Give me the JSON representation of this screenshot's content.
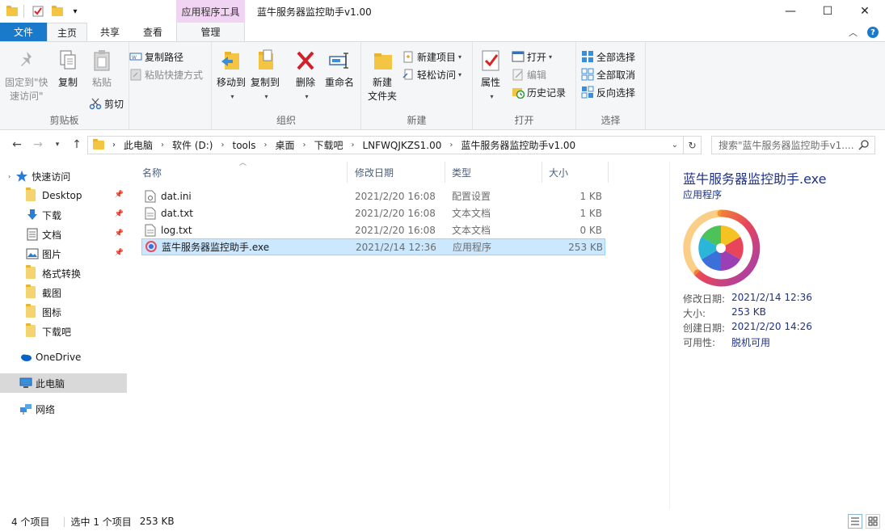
{
  "titlebar": {
    "context_tab_title": "应用程序工具",
    "window_title": "蓝牛服务器监控助手v1.00",
    "minimize": "—",
    "maximize": "☐",
    "close": "✕"
  },
  "tabs": {
    "file": "文件",
    "home": "主页",
    "share": "共享",
    "view": "查看",
    "manage": "管理",
    "collapse": "︿",
    "help": "?"
  },
  "ribbon": {
    "clipboard": {
      "label": "剪贴板",
      "pin_line1": "固定到\"快",
      "pin_line2": "速访问\"",
      "copy": "复制",
      "paste": "粘贴",
      "copy_path": "复制路径",
      "paste_shortcut": "粘贴快捷方式",
      "cut": "剪切"
    },
    "organize": {
      "label": "组织",
      "move_to": "移动到",
      "copy_to": "复制到",
      "delete": "删除",
      "rename": "重命名"
    },
    "new": {
      "label": "新建",
      "new_folder_line1": "新建",
      "new_folder_line2": "文件夹",
      "new_item": "新建项目",
      "easy_access": "轻松访问"
    },
    "open": {
      "label": "打开",
      "properties": "属性",
      "open": "打开",
      "edit": "编辑",
      "history": "历史记录"
    },
    "select": {
      "label": "选择",
      "select_all": "全部选择",
      "select_none": "全部取消",
      "invert": "反向选择"
    }
  },
  "address": {
    "crumbs": [
      "此电脑",
      "软件 (D:)",
      "tools",
      "桌面",
      "下载吧",
      "LNFWQJKZS1.00",
      "蓝牛服务器监控助手v1.00"
    ],
    "search_placeholder": "搜索\"蓝牛服务器监控助手v1...."
  },
  "sidebar": {
    "quick_access": "快速访问",
    "items": [
      {
        "label": "Desktop",
        "pinned": true
      },
      {
        "label": "下载",
        "pinned": true
      },
      {
        "label": "文档",
        "pinned": true
      },
      {
        "label": "图片",
        "pinned": true
      },
      {
        "label": "格式转换",
        "pinned": false
      },
      {
        "label": "截图",
        "pinned": false
      },
      {
        "label": "图标",
        "pinned": false
      },
      {
        "label": "下载吧",
        "pinned": false
      }
    ],
    "onedrive": "OneDrive",
    "this_pc": "此电脑",
    "network": "网络"
  },
  "filelist": {
    "columns": [
      "名称",
      "修改日期",
      "类型",
      "大小"
    ],
    "rows": [
      {
        "name": "dat.ini",
        "date": "2021/2/20 16:08",
        "type": "配置设置",
        "size": "1 KB"
      },
      {
        "name": "dat.txt",
        "date": "2021/2/20 16:08",
        "type": "文本文档",
        "size": "1 KB"
      },
      {
        "name": "log.txt",
        "date": "2021/2/20 16:08",
        "type": "文本文档",
        "size": "0 KB"
      },
      {
        "name": "蓝牛服务器监控助手.exe",
        "date": "2021/2/14 12:36",
        "type": "应用程序",
        "size": "253 KB"
      }
    ]
  },
  "preview": {
    "title": "蓝牛服务器监控助手.exe",
    "type": "应用程序",
    "fields": [
      {
        "key": "修改日期:",
        "value": "2021/2/14 12:36"
      },
      {
        "key": "大小:",
        "value": "253 KB"
      },
      {
        "key": "创建日期:",
        "value": "2021/2/20 14:26"
      },
      {
        "key": "可用性:",
        "value": "脱机可用"
      }
    ]
  },
  "status": {
    "count": "4 个项目",
    "selected": "选中 1 个项目",
    "selected_size": "253 KB"
  },
  "colors": {
    "accent": "#1979ca",
    "selection": "#cce8ff",
    "context_tab": "#f1d4f3"
  }
}
